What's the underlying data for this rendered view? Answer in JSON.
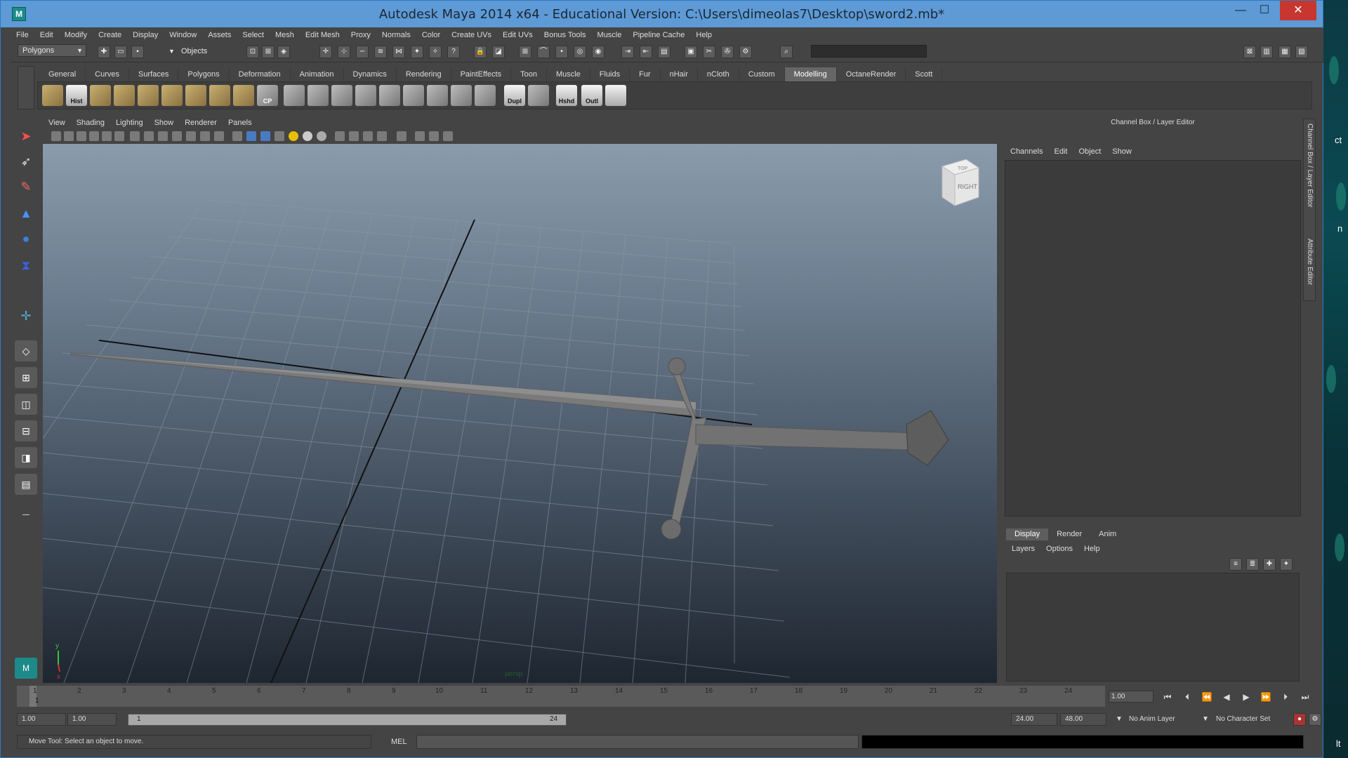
{
  "window": {
    "title": "Autodesk Maya 2014 x64 - Educational Version: C:\\Users\\dimeolas7\\Desktop\\sword2.mb*",
    "logo": "M",
    "minimize": "—",
    "maximize": "☐",
    "close": "✕"
  },
  "menubar": [
    "File",
    "Edit",
    "Modify",
    "Create",
    "Display",
    "Window",
    "Assets",
    "Select",
    "Mesh",
    "Edit Mesh",
    "Proxy",
    "Normals",
    "Color",
    "Create UVs",
    "Edit UVs",
    "Bonus Tools",
    "Muscle",
    "Pipeline Cache",
    "Help"
  ],
  "statusline": {
    "mode": "Polygons",
    "selection_mode": "Objects"
  },
  "shelf": {
    "tabs": [
      "General",
      "Curves",
      "Surfaces",
      "Polygons",
      "Deformation",
      "Animation",
      "Dynamics",
      "Rendering",
      "PaintEffects",
      "Toon",
      "Muscle",
      "Fluids",
      "Fur",
      "nHair",
      "nCloth",
      "Custom",
      "Modelling",
      "OctaneRender",
      "Scott"
    ],
    "active_tab": "Modelling",
    "labeled_icons": {
      "hist": "Hist",
      "cp": "CP",
      "dupl": "Dupl",
      "hshd": "Hshd",
      "outl": "Outl"
    }
  },
  "viewport": {
    "menus": [
      "View",
      "Shading",
      "Lighting",
      "Show",
      "Renderer",
      "Panels"
    ],
    "camera_label": "persp",
    "viewcube_label": "RIGHT",
    "viewcube_top": "TOP",
    "axis_x": "x",
    "axis_y": "y"
  },
  "channel_box": {
    "title": "Channel Box / Layer Editor",
    "menus": [
      "Channels",
      "Edit",
      "Object",
      "Show"
    ],
    "side_tabs": [
      "Channel Box / Layer Editor",
      "Attribute Editor"
    ]
  },
  "layer_editor": {
    "tabs": [
      "Display",
      "Render",
      "Anim"
    ],
    "active_tab": "Display",
    "menus": [
      "Layers",
      "Options",
      "Help"
    ]
  },
  "timeline": {
    "ticks": [
      "1",
      "2",
      "3",
      "4",
      "5",
      "6",
      "7",
      "8",
      "9",
      "10",
      "11",
      "12",
      "13",
      "14",
      "15",
      "16",
      "17",
      "18",
      "19",
      "20",
      "21",
      "22",
      "23",
      "24"
    ],
    "current_frame": "1",
    "current_time": "1.00"
  },
  "range": {
    "start_time": "1.00",
    "playback_start": "1.00",
    "slider_start": "1",
    "slider_end": "24",
    "playback_end": "24.00",
    "end_time": "48.00",
    "anim_layer": "No Anim Layer",
    "character_set": "No Character Set"
  },
  "helpline": {
    "text": "Move Tool: Select an object to move.",
    "mel_label": "MEL"
  },
  "desktop": {
    "snippets": [
      "ct",
      "n",
      "lt"
    ]
  }
}
